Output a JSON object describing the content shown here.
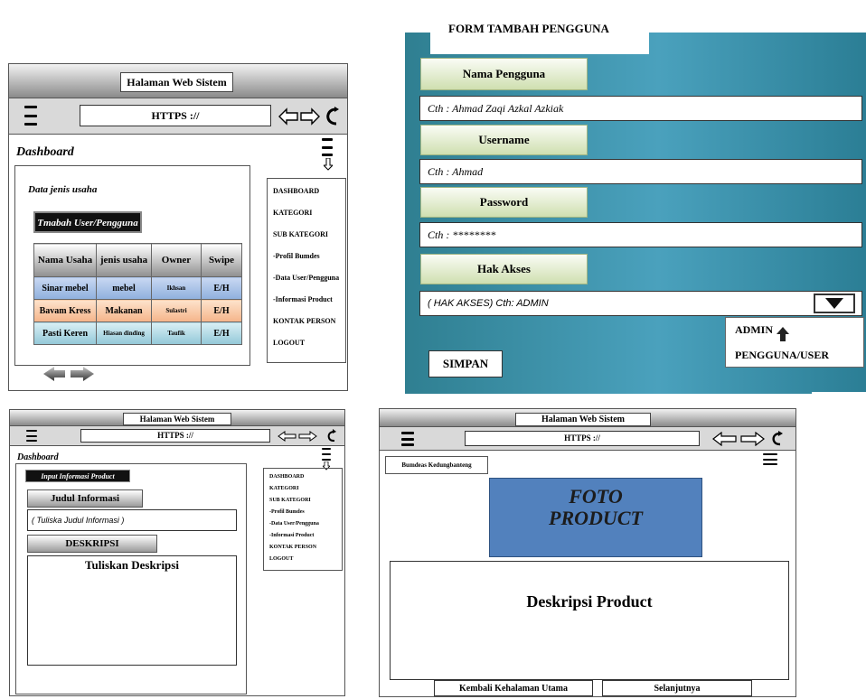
{
  "panel1": {
    "window_title": "Halaman Web Sistem",
    "url": "HTTPS ://",
    "page_title": "Dashboard",
    "section_label": "Data jenis usaha",
    "add_button": "Tmabah User/Pengguna",
    "table": {
      "headers": [
        "Nama Usaha",
        "jenis usaha",
        "Owner",
        "Swipe"
      ],
      "rows": [
        [
          "Sinar mebel",
          "mebel",
          "Ikhsan",
          "E/H"
        ],
        [
          "Bavam Kress",
          "Makanan",
          "Sulastri",
          "E/H"
        ],
        [
          "Pasti Keren",
          "Hiasan dinding",
          "Taufik",
          "E/H"
        ]
      ]
    },
    "menu": [
      "DASHBOARD",
      "KATEGORI",
      "SUB KATEGORI",
      "-Profil Bumdes",
      "-Data User/Pengguna",
      "-Informasi Product",
      "KONTAK PERSON",
      "LOGOUT"
    ]
  },
  "panel2": {
    "form_title": "FORM TAMBAH PENGGUNA",
    "name_label": "Nama Pengguna",
    "name_placeholder": "Cth : Ahmad Zaqi Azkal Azkiak",
    "username_label": "Username",
    "username_placeholder": "Cth : Ahmad",
    "password_label": "Password",
    "password_placeholder": "Cth : ********",
    "access_label": "Hak Akses",
    "access_placeholder": "( HAK AKSES) Cth: ADMIN",
    "options": [
      "ADMIN",
      "PENGGUNA/USER"
    ],
    "save_button": "SIMPAN"
  },
  "panel3": {
    "window_title": "Halaman Web Sistem",
    "url": "HTTPS ://",
    "page_title": "Dashboard",
    "section_button": "Input Informasi Product",
    "title_label": "Judul Informasi",
    "title_placeholder": "( Tuliska Judul Informasi )",
    "desc_label": "DESKRIPSI",
    "desc_placeholder": "Tuliskan Deskripsi",
    "menu": [
      "DASHBOARD",
      "KATEGORI",
      "SUB KATEGORI",
      "-Profil Bumdes",
      "-Data User/Pengguna",
      "-Informasi Product",
      "KONTAK PERSON",
      "LOGOUT"
    ]
  },
  "panel4": {
    "window_title": "Halaman Web Sistem",
    "url": "HTTPS ://",
    "site_name": "Bumdeas Kedungbanteng",
    "photo_line1": "FOTO",
    "photo_line2": "PRODUCT",
    "description": "Deskripsi Product",
    "back_button": "Kembali Kehalaman Utama",
    "next_button": "Selanjutnya"
  },
  "colors": {
    "form_bg": "#3a8fa8",
    "photo_bg": "#5281bd",
    "row1": "#a9c2e8",
    "row2": "#f8c9a6",
    "row3": "#b3dbe6"
  }
}
